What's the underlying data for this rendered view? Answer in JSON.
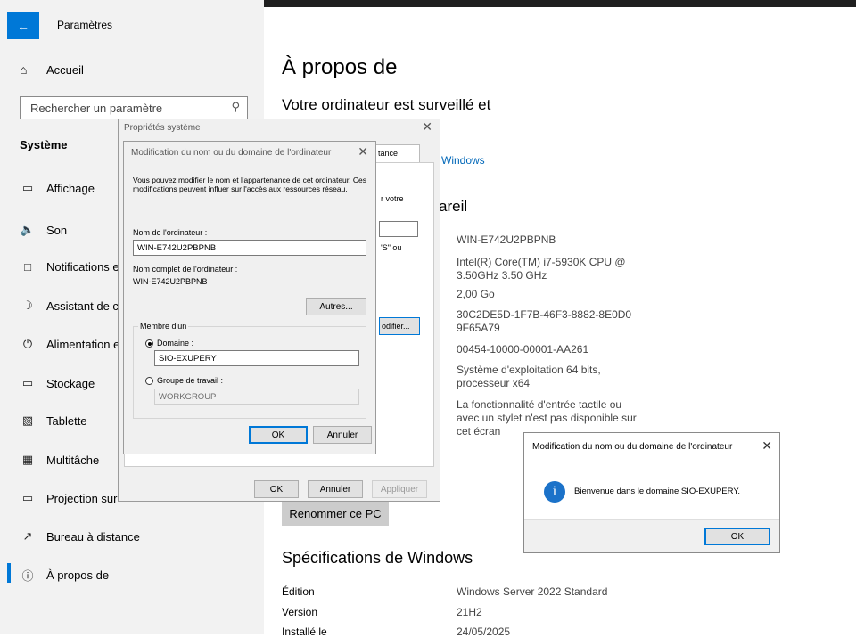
{
  "sidebar": {
    "title": "Paramètres",
    "home": "Accueil",
    "search_placeholder": "Rechercher un paramètre",
    "section": "Système",
    "items": [
      {
        "label": "Affichage",
        "icon": "display-icon"
      },
      {
        "label": "Son",
        "icon": "speaker-icon"
      },
      {
        "label": "Notifications et actions",
        "icon": "notification-icon"
      },
      {
        "label": "Assistant de concentration",
        "icon": "moon-icon"
      },
      {
        "label": "Alimentation et mise en veille",
        "icon": "power-icon"
      },
      {
        "label": "Stockage",
        "icon": "storage-icon"
      },
      {
        "label": "Tablette",
        "icon": "tablet-icon"
      },
      {
        "label": "Multitâche",
        "icon": "multitask-icon"
      },
      {
        "label": "Projection sur ce PC",
        "icon": "projection-icon"
      },
      {
        "label": "Bureau à distance",
        "icon": "remote-desktop-icon"
      },
      {
        "label": "À propos de",
        "icon": "info-icon",
        "active": true
      }
    ]
  },
  "content": {
    "title": "À propos de",
    "subtitle": "Votre ordinateur est surveillé et",
    "link": "Windows",
    "device_heading": "areil",
    "device_values": [
      "WIN-E742U2PBPNB",
      "Intel(R) Core(TM) i7-5930K CPU @ 3.50GHz   3.50 GHz",
      "2,00 Go",
      "30C2DE5D-1F7B-46F3-8882-8E0D09F65A79",
      "00454-10000-00001-AA261",
      "Système d'exploitation 64 bits, processeur x64",
      "La fonctionnalité d'entrée tactile ou avec un stylet n'est pas disponible sur cet écran"
    ],
    "rename_button": "Renommer ce PC",
    "win_specs_heading": "Spécifications de Windows",
    "win_specs": [
      {
        "label": "Édition",
        "value": "Windows Server 2022 Standard"
      },
      {
        "label": "Version",
        "value": "21H2"
      },
      {
        "label": "Installé le",
        "value": "24/05/2025"
      }
    ]
  },
  "sysprops": {
    "title": "Propriétés système",
    "tab_fragment": "tance",
    "frag1": "r votre",
    "frag2": "'S\" ou",
    "modify_fragment": "odifier...",
    "ok": "OK",
    "cancel": "Annuler",
    "apply": "Appliquer"
  },
  "modify_dialog": {
    "title": "Modification du nom ou du domaine de l'ordinateur",
    "description": "Vous pouvez modifier le nom et l'appartenance de cet ordinateur. Ces modifications peuvent influer sur l'accès aux ressources réseau.",
    "computer_name_label": "Nom de l'ordinateur :",
    "computer_name_value": "WIN-E742U2PBPNB",
    "full_name_label": "Nom complet de l'ordinateur :",
    "full_name_value": "WIN-E742U2PBPNB",
    "more_button": "Autres...",
    "member_of": "Membre d'un",
    "domain_label": "Domaine :",
    "domain_value": "SIO-EXUPERY",
    "workgroup_label": "Groupe de travail :",
    "workgroup_value": "WORKGROUP",
    "ok": "OK",
    "cancel": "Annuler"
  },
  "welcome_dialog": {
    "title": "Modification du nom ou du domaine de l'ordinateur",
    "message": "Bienvenue dans le domaine SIO-EXUPERY.",
    "ok": "OK"
  }
}
